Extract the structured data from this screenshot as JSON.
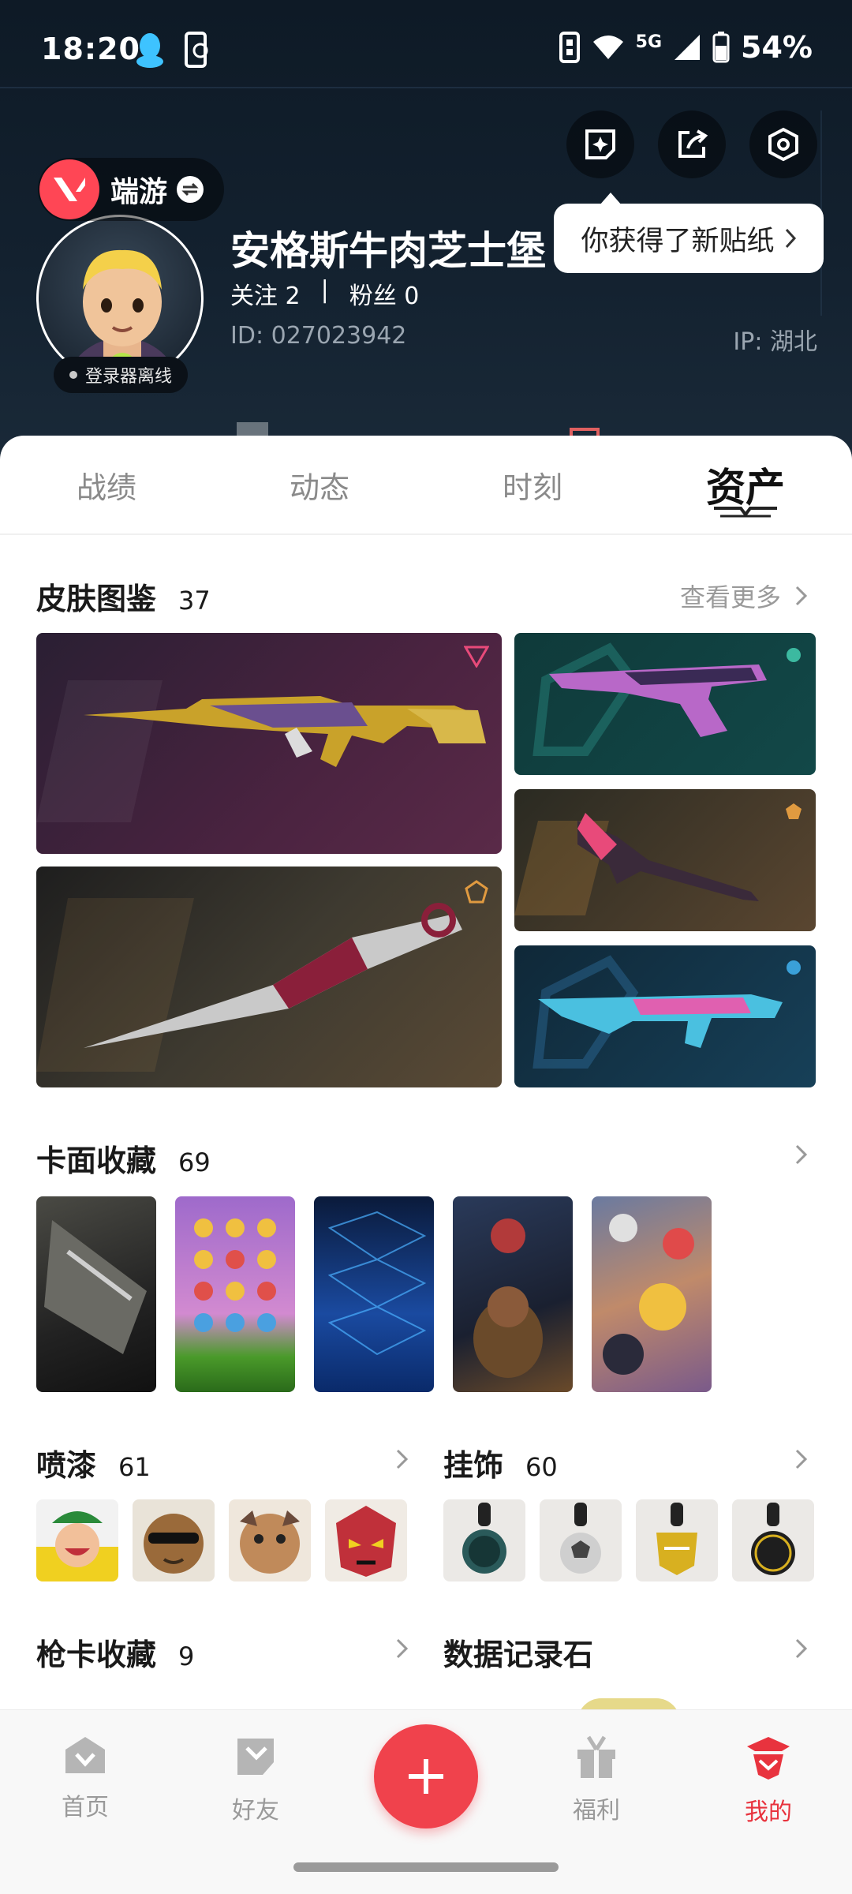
{
  "status_bar": {
    "time": "18:20",
    "network": "5G",
    "battery": "54%"
  },
  "header": {
    "game_name": "端游",
    "username": "安格斯牛肉芝士堡",
    "follow_label": "关注",
    "follow_count": "2",
    "divider": "|",
    "fans_label": "粉丝",
    "fans_count": "0",
    "id_label": "ID:",
    "id_value": "027023942",
    "ip_label": "IP:",
    "ip_value": "湖北",
    "status_tag": "登录器离线",
    "sticker_tip": "你获得了新贴纸",
    "actions": [
      "sticker-icon",
      "share-icon",
      "settings-icon"
    ]
  },
  "tabs": [
    {
      "label": "战绩",
      "active": false
    },
    {
      "label": "动态",
      "active": false
    },
    {
      "label": "时刻",
      "active": false
    },
    {
      "label": "资产",
      "active": true
    }
  ],
  "skins": {
    "title": "皮肤图鉴",
    "count": "37",
    "more": "查看更多"
  },
  "cards": {
    "title": "卡面收藏",
    "count": "69"
  },
  "sprays": {
    "title": "喷漆",
    "count": "61"
  },
  "charms": {
    "title": "挂饰",
    "count": "60"
  },
  "gun_cards": {
    "title": "枪卡收藏",
    "count": "9"
  },
  "data_stone": {
    "title": "数据记录石"
  },
  "bottom_nav": [
    {
      "label": "首页",
      "icon": "home-icon",
      "active": false
    },
    {
      "label": "好友",
      "icon": "friends-icon",
      "active": false
    },
    {
      "label": "福利",
      "icon": "gift-icon",
      "active": false
    },
    {
      "label": "我的",
      "icon": "profile-icon",
      "active": true
    }
  ],
  "colors": {
    "accent": "#f0424c",
    "brand_valorant": "#ff4655",
    "header_bg": "#13212f"
  }
}
